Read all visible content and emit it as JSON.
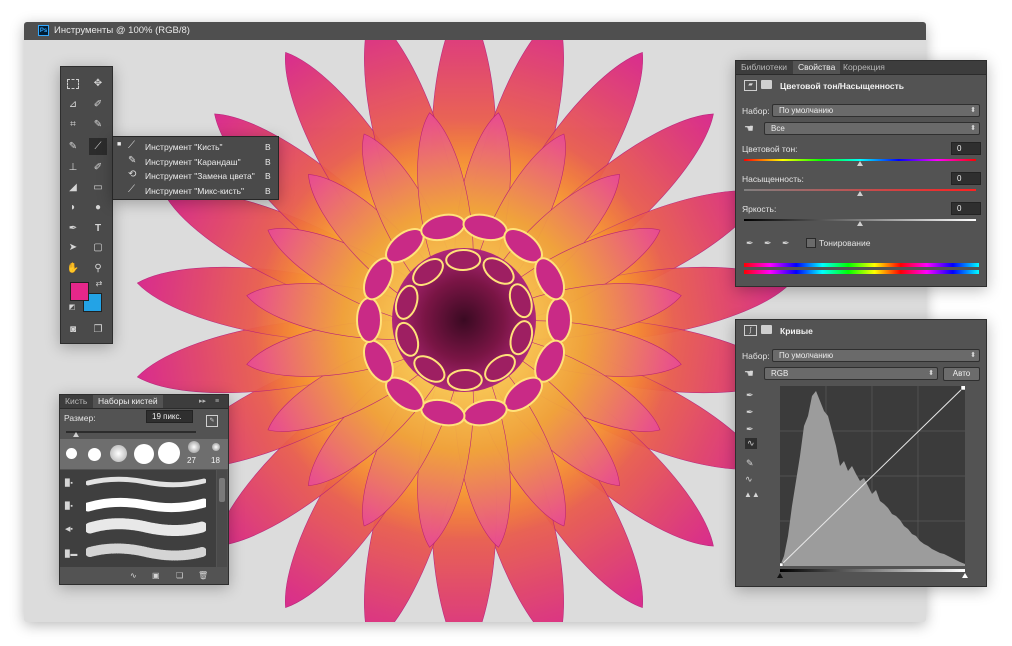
{
  "window": {
    "title": "Инструменты @ 100% (RGB/8)",
    "ps_badge": "Ps"
  },
  "flyout": {
    "items": [
      {
        "label": "Инструмент \"Кисть\"",
        "key": "B",
        "active": true
      },
      {
        "label": "Инструмент \"Карандаш\"",
        "key": "B",
        "active": false
      },
      {
        "label": "Инструмент \"Замена цвета\"",
        "key": "B",
        "active": false
      },
      {
        "label": "Инструмент \"Микс-кисть\"",
        "key": "B",
        "active": false
      }
    ]
  },
  "toolbar": {
    "foreground_color": "#e5278a",
    "background_color": "#23a3e6"
  },
  "props_panel": {
    "tabs": [
      "Библиотеки",
      "Свойства",
      "Коррекция"
    ],
    "active_tab": "Свойства",
    "title": "Цветовой тон/Насыщенность",
    "preset_label": "Набор:",
    "preset_value": "По умолчанию",
    "channel_value": "Все",
    "hue_label": "Цветовой тон:",
    "hue_value": "0",
    "saturation_label": "Насыщенность:",
    "saturation_value": "0",
    "lightness_label": "Яркость:",
    "lightness_value": "0",
    "colorize_label": "Тонирование"
  },
  "curves_panel": {
    "title": "Кривые",
    "preset_label": "Набор:",
    "preset_value": "По умолчанию",
    "channel_value": "RGB",
    "auto_button": "Авто"
  },
  "brush_panel": {
    "tabs": [
      "Кисть",
      "Наборы кистей"
    ],
    "active_tab": "Наборы кистей",
    "size_label": "Размер:",
    "size_value": "19 пикс.",
    "preset_sizes": [
      "27",
      "18"
    ]
  }
}
